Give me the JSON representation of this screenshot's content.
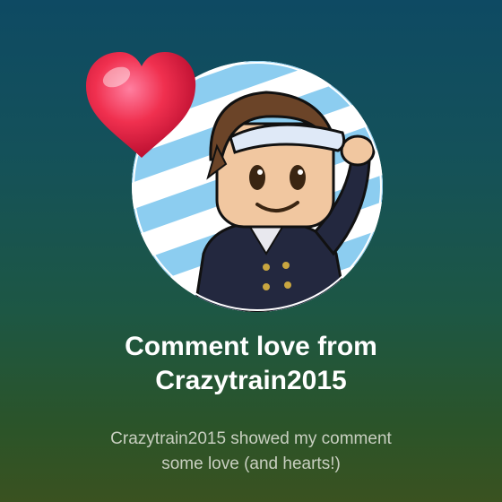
{
  "notification": {
    "title_line1": "Comment love from",
    "title_line2": "Crazytrain2015",
    "message_line1": "Crazytrain2015 showed my comment",
    "message_line2": "some love (and hearts!)",
    "icons": {
      "badge": "heart-icon",
      "avatar": "user-avatar"
    },
    "colors": {
      "title": "#ffffff",
      "message": "#c8cfc0",
      "heart": "#e8244f"
    }
  }
}
